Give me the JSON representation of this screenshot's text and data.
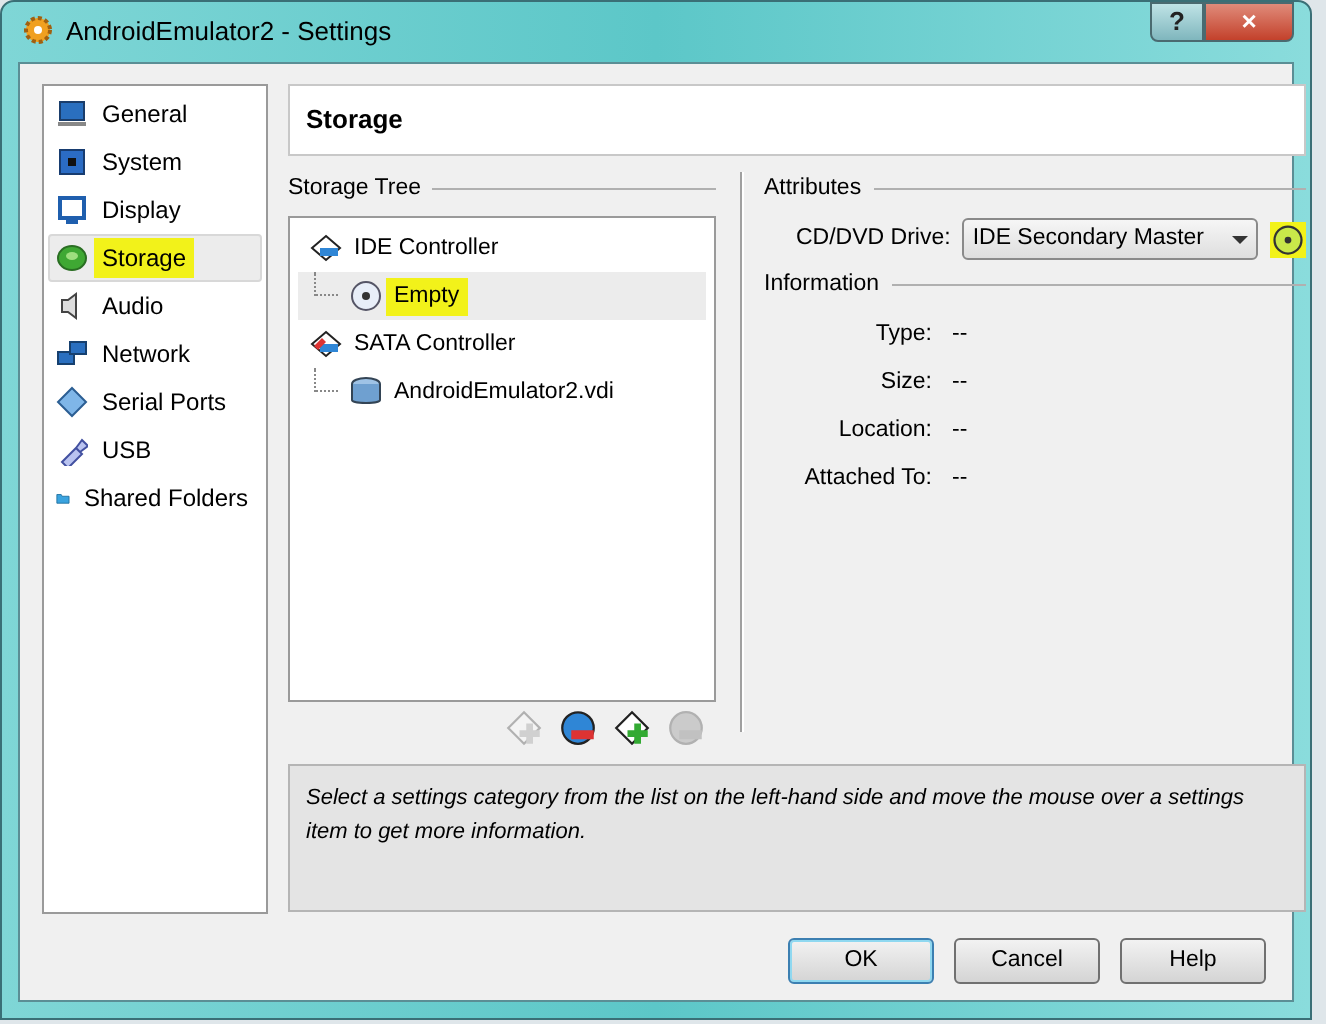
{
  "window": {
    "title": "AndroidEmulator2 - Settings",
    "buttons": [
      "?",
      "×"
    ]
  },
  "sidebar": {
    "items": [
      {
        "label": "General",
        "kind": "monitor",
        "selected": false,
        "highlighted": false
      },
      {
        "label": "System",
        "kind": "chip",
        "selected": false,
        "highlighted": false
      },
      {
        "label": "Display",
        "kind": "display",
        "selected": false,
        "highlighted": false
      },
      {
        "label": "Storage",
        "kind": "disk",
        "selected": true,
        "highlighted": true
      },
      {
        "label": "Audio",
        "kind": "speaker",
        "selected": false,
        "highlighted": false
      },
      {
        "label": "Network",
        "kind": "network",
        "selected": false,
        "highlighted": false
      },
      {
        "label": "Serial Ports",
        "kind": "port",
        "selected": false,
        "highlighted": false
      },
      {
        "label": "USB",
        "kind": "usb",
        "selected": false,
        "highlighted": false
      },
      {
        "label": "Shared Folders",
        "kind": "folder",
        "selected": false,
        "highlighted": false
      }
    ]
  },
  "page_title": "Storage",
  "storage_tree": {
    "title": "Storage Tree",
    "items": [
      {
        "label": "IDE Controller",
        "kind": "controller",
        "selected": false,
        "highlighted": false,
        "children": [
          {
            "label": "Empty",
            "kind": "cd",
            "selected": true,
            "highlighted": true
          }
        ]
      },
      {
        "label": "SATA Controller",
        "kind": "sata",
        "selected": false,
        "highlighted": false,
        "children": [
          {
            "label": "AndroidEmulator2.vdi",
            "kind": "hdd",
            "selected": false,
            "highlighted": false
          }
        ]
      }
    ],
    "toolbar": [
      {
        "kind": "add",
        "disabled": true
      },
      {
        "kind": "remove",
        "disabled": false
      },
      {
        "kind": "add",
        "disabled": false
      },
      {
        "kind": "remove",
        "disabled": true
      }
    ]
  },
  "attributes": {
    "title": "Attributes",
    "drive_label": "CD/DVD Drive:",
    "drive_value": "IDE Secondary Master",
    "choose_disk_highlighted": true
  },
  "information": {
    "title": "Information",
    "rows": [
      {
        "label": "Type:",
        "value": "--"
      },
      {
        "label": "Size:",
        "value": "--"
      },
      {
        "label": "Location:",
        "value": "--"
      },
      {
        "label": "Attached To:",
        "value": "--"
      }
    ]
  },
  "description": "Select a settings category from the list on the left-hand side and move the mouse over a settings item to get more information.",
  "buttons": [
    {
      "label": "OK",
      "default": true
    },
    {
      "label": "Cancel",
      "default": false
    },
    {
      "label": "Help",
      "default": false
    }
  ]
}
